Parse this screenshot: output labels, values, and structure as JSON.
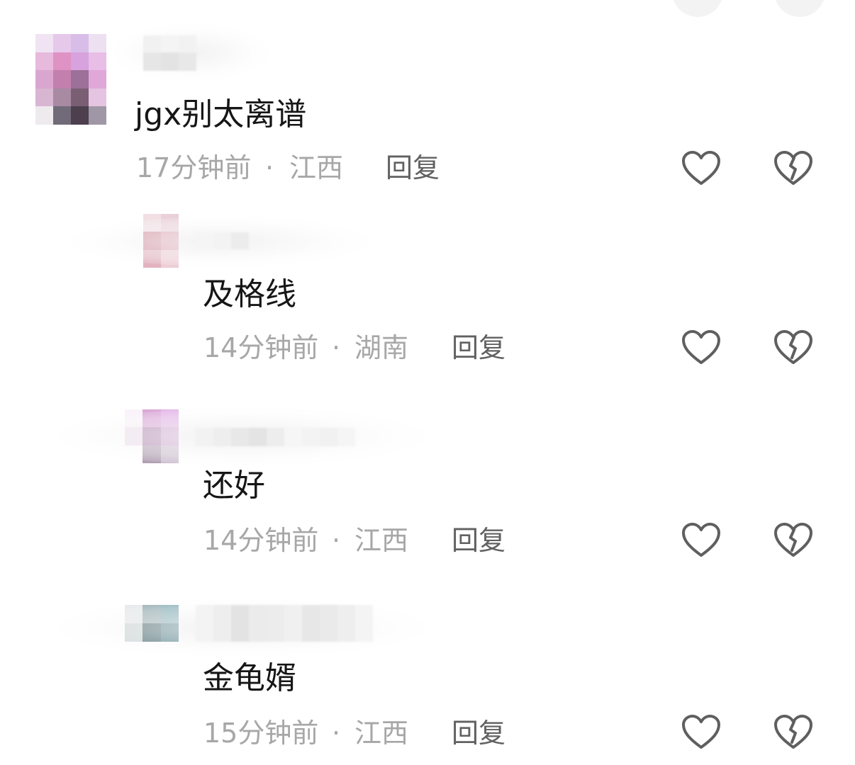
{
  "comments": [
    {
      "text": "jgx别太离谱",
      "time": "17分钟前",
      "sep": "·",
      "location": "江西",
      "reply_label": "回复"
    },
    {
      "text": "及格线",
      "time": "14分钟前",
      "sep": "·",
      "location": "湖南",
      "reply_label": "回复"
    },
    {
      "text": "还好",
      "time": "14分钟前",
      "sep": "·",
      "location": "江西",
      "reply_label": "回复"
    },
    {
      "text": "金龟婿",
      "time": "15分钟前",
      "sep": "·",
      "location": "江西",
      "reply_label": "回复"
    }
  ],
  "icons": {
    "like": "heart-outline-icon",
    "dislike": "broken-heart-icon"
  },
  "colors": {
    "comment_text": "#161616",
    "meta_text": "#a7a7a7",
    "reply_text": "#616161",
    "icon_stroke": "#5f5f5f",
    "avatar_1_tone": "#d9a6d9",
    "avatar_2_tone": "#d48a9c",
    "avatar_3_tone": "#c08fc0",
    "avatar_4_tone": "#4a7a84"
  }
}
